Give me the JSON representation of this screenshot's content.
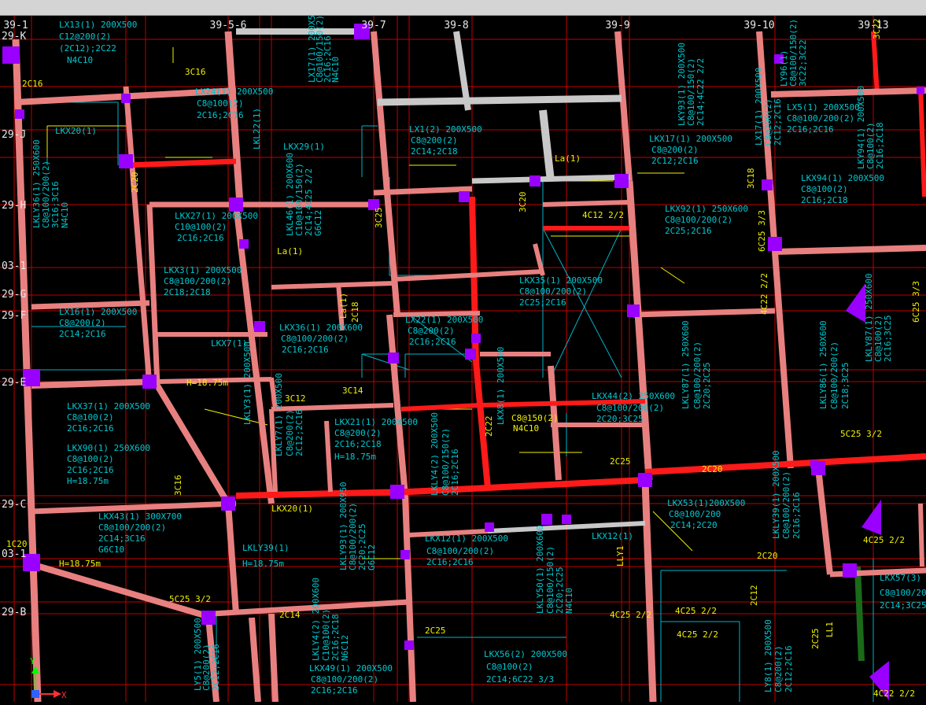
{
  "canvas": {
    "background": "#000000",
    "toolbar_color": "#d4d4d4"
  },
  "colors": {
    "beam_fill": "#e88080",
    "beam_gray": "#c8c8c8",
    "beam_red": "#ff1a1a",
    "column": "#9900ff",
    "grid_line": "#c00000",
    "annotation_cyan": "#00c8d0",
    "annotation_yellow": "#f0f000",
    "slab_cyan": "#00b4c8"
  },
  "grid_top": [
    "39-1",
    "39-5-6",
    "39-7",
    "39-8",
    "39-9",
    "39-10",
    "39-13"
  ],
  "grid_left": [
    "29-K",
    "29-J",
    "29-H",
    "03-1",
    "29-G",
    "29-F",
    "29-E",
    "29-C",
    "03-1",
    "29-B"
  ],
  "labels_cyan": [
    "LX13(1) 200X500",
    "C12@200(2)",
    "(2C12);2C22",
    "N4C10",
    "LX24(1) 200X500",
    "C8@100(2)",
    "2C16;2C16",
    "LX17(1) 200X500",
    "C8@100/150(2)",
    "2C16;2C16",
    "N4C10",
    "LKL22(1)",
    "LKX29(1)",
    "LKX20(1)",
    "LKLY36(1) 250X600",
    "C8@100/200(2)",
    "3C16;3C16",
    "N4C10",
    "LKX27(1) 200X500",
    "C10@100(2)",
    "2C16;2C16",
    "LKL46(1) 200X600",
    "C10@100/150(2)",
    "2C14;4C25 2/2",
    "G6C12",
    "LX1(2) 200X500",
    "C8@200(2)",
    "2C14;2C18",
    "LKX3(1) 200X500",
    "C8@100/200(2)",
    "2C18;2C18",
    "LKX35(1) 200X500",
    "C8@100/200(2)",
    "2C25;2C16",
    "LX16(1) 200X500",
    "C8@200(2)",
    "2C14;2C16",
    "LKX36(1) 200X600",
    "C8@100/200(2)",
    "2C16;2C16",
    "LKX7(1)",
    "LX22(1) 200X500",
    "C8@200(2)",
    "2C16;2C16",
    "LKLY3(1) 200X500",
    "LKX8(1) 200X500",
    "LKX37(1) 200X500",
    "C8@100(2)",
    "2C16;2C16",
    "LKX90(1) 250X600",
    "C8@100(2)",
    "2C16;2C16",
    "H=18.75m",
    "LKLY7(1) 200X500",
    "C8@200(2)",
    "2C12;2C16",
    "LKX21(1) 200X500",
    "C8@200(2)",
    "2C16;2C18",
    "H=18.75m",
    "LKLY4(2) 200X500",
    "C8@100/150(2)",
    "2C16;2C16",
    "LKX44(2) 250X600",
    "C8@100/200(2)",
    "2C20;3C25",
    "LKX17(1) 200X500",
    "C8@200(2)",
    "2C12;2C16",
    "LKX92(1) 250X600",
    "C8@100/200(2)",
    "2C25;2C16",
    "LKY94(1) 200X500",
    "C8@100(2)",
    "2C16;2C18",
    "LKLY87(1) 250X600",
    "C8@100/200(2)",
    "2C20;2C25",
    "LKLY86(1) 250X600",
    "C8@100/200(2)",
    "2C18;3C25",
    "LKLY87(1) 250X600",
    "C8@100(2)",
    "2C16;3C25",
    "LKX43(1) 300X700",
    "C8@100/200(2)",
    "2C14;3C16",
    "G6C10",
    "LKLY39(1)",
    "H=18.75m",
    "LKLY93(1) 200X950",
    "C8@100/200(2)",
    "2C20;2C25",
    "G6C12",
    "LKX12(1) 200X500",
    "C8@100/200(2)",
    "2C16;2C16",
    "LKLY50(1) 200X600",
    "C8@100/150(2)",
    "2C20;2C25",
    "N4C10",
    "LKX12(1)",
    "LKX53(1)200X500",
    "C8@100/200",
    "2C14;2C20",
    "LKLY39(1) 200X500",
    "C8@100/200(2)",
    "2C16;2C16",
    "LKX57(3)",
    "C8@100/200",
    "2C14;3C25",
    "LKLY4(2) 200X600",
    "C10@100(2)",
    "2C16;2C18",
    "N6C12",
    "LKX49(1) 200X500",
    "C8@100/200(2)",
    "2C16;2C16",
    "LY5(1) 200X500",
    "C8@200(2)",
    "2C12;2C16",
    "LKX56(2) 200X500",
    "C8@100(2)",
    "2C14;6C22 3/3",
    "LY8(1) 200X500",
    "C8@200(2)",
    "2C12;2C16",
    "LX17(1) 200X500",
    "C8@200(2)",
    "2C12;2C16",
    "LY96(1)",
    "C8@100/150(2)",
    "3C22;3C22",
    "LKY93(1) 200X500",
    "C8@100/150(2)",
    "2C14;4C22 2/2",
    "LKX94(1) 200X500",
    "C8@100(2)",
    "2C16;2C18",
    "LX5(1) 200X500",
    "C8@100/200(2)",
    "2C16;2C16"
  ],
  "labels_yellow": [
    "2C16",
    "3C16",
    "2C20",
    "3C20",
    "3C12",
    "3C14",
    "3C25",
    "2C25",
    "2C14",
    "2C12",
    "4C12 2/2",
    "5C25 3/2",
    "4C25 2/2",
    "6C25 3/3",
    "4C22 2/2",
    "C8@150(2)",
    "N4C10",
    "H=18.75m",
    "La(1)",
    "2C18",
    "3C18",
    "2C22",
    "3C22",
    "5C25 3/2",
    "4C25 2/2",
    "H=18.75m",
    "2C25",
    "LLY1",
    "LL1",
    "3C16",
    "2C20",
    "2C25",
    "4C25 2/2",
    "4C25 2/2",
    "1C20",
    "2C20",
    "4C22 2/2",
    "6C25 3/3",
    "LKX20(1)",
    "La(1)",
    "La(1)"
  ],
  "axis": {
    "x": "X",
    "y": "Y"
  }
}
